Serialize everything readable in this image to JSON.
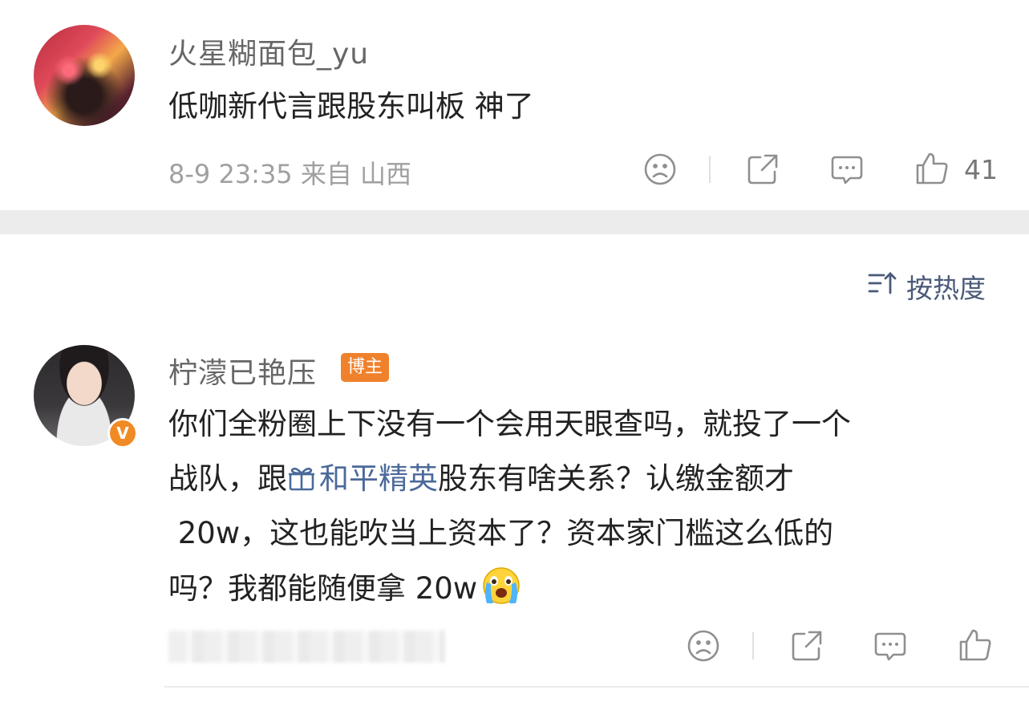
{
  "comment1": {
    "username": "火星糊面包_yu",
    "content": "低咖新代言跟股东叫板 神了",
    "meta": "8-9 23:35 来自 山西",
    "like_count": "41"
  },
  "sort": {
    "label": "按热度"
  },
  "comment2": {
    "username": "柠濛已艳压",
    "badge": "博主",
    "verified_mark": "V",
    "content_line1": "你们全粉圈上下没有一个会用天眼查吗，就投了一个",
    "content_line2_a": "战队，跟",
    "topic": "和平精英",
    "content_line2_b": "股东有啥关系？认缴金额才",
    "content_line3": " 20w，这也能吹当上资本了？资本家门槛这么低的",
    "content_line4": "吗？我都能随便拿 20w"
  },
  "colors": {
    "accent_orange": "#f0812c",
    "topic_blue": "#4b6a9a",
    "icon_gray": "#8f8f8f"
  },
  "icons": [
    "sad-face-icon",
    "share-icon",
    "comment-icon",
    "thumbs-up-icon",
    "sort-icon",
    "gift-icon",
    "crying-emoji"
  ]
}
